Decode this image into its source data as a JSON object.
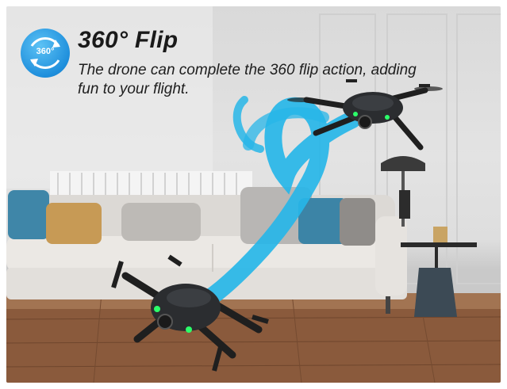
{
  "badge": {
    "text": "360°"
  },
  "title": "360° Flip",
  "description": "The drone can complete the 360 flip action, adding fun to your flight.",
  "colors": {
    "accent_blue": "#1f8fdc",
    "trail_cyan": "#27b6e8",
    "drone_body": "#2b2d30",
    "led_green": "#2cff6a",
    "floor": "#8a5a3c",
    "sofa": "#e6e3df"
  },
  "icons": [
    "rotate-360-icon"
  ]
}
